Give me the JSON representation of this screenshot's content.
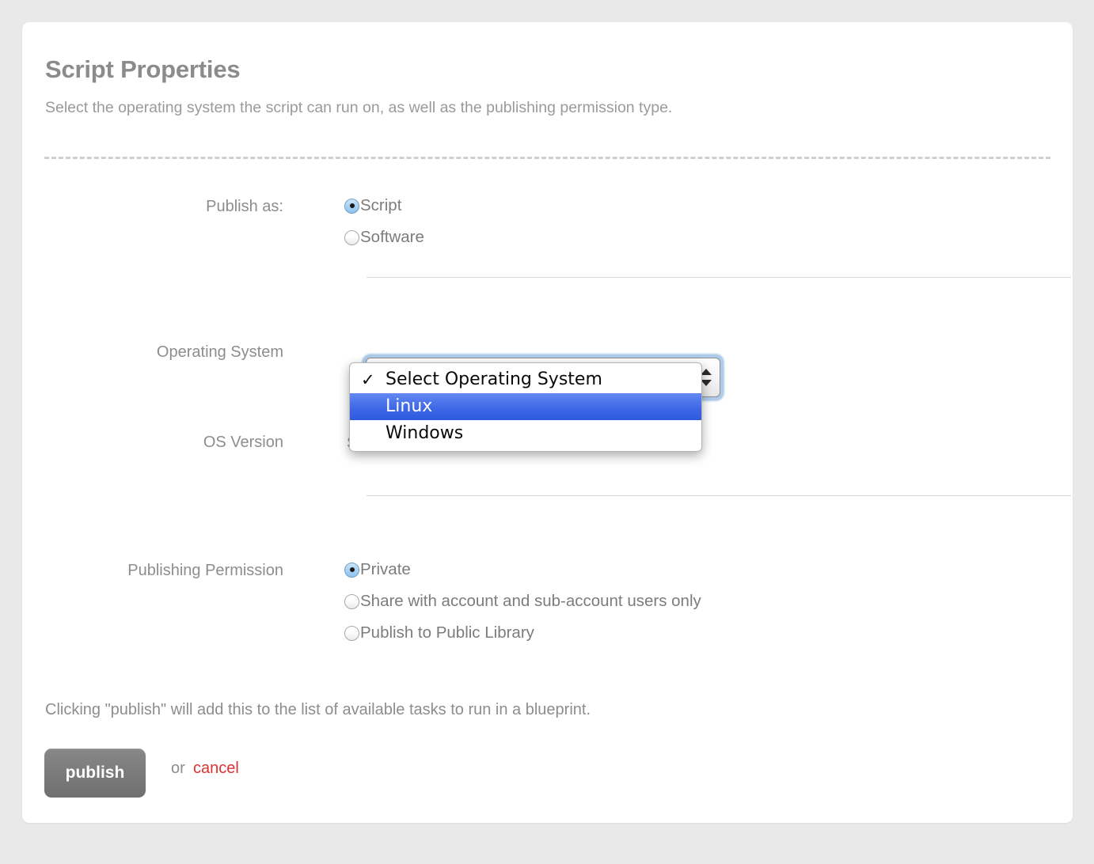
{
  "page": {
    "title": "Script Properties",
    "subtitle": "Select the operating system the script can run on, as well as the publishing permission type."
  },
  "form": {
    "publish_as": {
      "label": "Publish as:",
      "options": [
        {
          "label": "Script",
          "selected": true
        },
        {
          "label": "Software",
          "selected": false
        }
      ]
    },
    "operating_system": {
      "label": "Operating System",
      "selected_value": "Select Operating System",
      "dropdown_open": true,
      "options": [
        {
          "label": "Select Operating System",
          "checked": true,
          "highlighted": false
        },
        {
          "label": "Linux",
          "checked": false,
          "highlighted": true
        },
        {
          "label": "Windows",
          "checked": false,
          "highlighted": false
        }
      ]
    },
    "os_version": {
      "label": "OS Version",
      "value": "Select an Operating System"
    },
    "publishing_permission": {
      "label": "Publishing Permission",
      "options": [
        {
          "label": "Private",
          "selected": true
        },
        {
          "label": "Share with account and sub-account users only",
          "selected": false
        },
        {
          "label": "Publish to Public Library",
          "selected": false
        }
      ]
    }
  },
  "footer": {
    "note": "Clicking \"publish\" will add this to the list of available tasks to run in a blueprint.",
    "publish_label": "publish",
    "or_label": "or",
    "cancel_label": "cancel"
  },
  "colors": {
    "page_background": "#e9e9e9",
    "card_background": "#ffffff",
    "text_gray": "#8d8d8d",
    "title_gray": "#8b8b8b",
    "highlight_blue": "#3f68e6",
    "cancel_red": "#e03131",
    "publish_button_gray": "#7b7b7b",
    "focus_ring_blue": "#aecbe9"
  },
  "icons": {
    "select_arrows": "up-down-arrows-icon",
    "checkmark": "checkmark-icon"
  }
}
